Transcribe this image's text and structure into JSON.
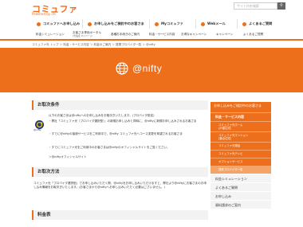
{
  "header": {
    "logo": "コミュファ",
    "logo_sub": "Powered by ctc",
    "search_placeholder": "サイト内を検索",
    "search_button": "Q",
    "topnav": [
      {
        "label": "コミュファへお申し込み"
      },
      {
        "label": "お申し込みをご検討中のお客さま"
      },
      {
        "label": "Myコミュファ"
      },
      {
        "label": "Webメール"
      },
      {
        "label": "よくあるご質問"
      }
    ],
    "subnav": [
      {
        "label": "料金シミュレーション",
        "small": ""
      },
      {
        "label": "お客さま専用ポータル",
        "small": "(光電話 マイページ)"
      },
      {
        "label": "各種お手続きのご案内",
        "small": ""
      },
      {
        "label": "料金・サービス内容",
        "small": ""
      },
      {
        "label": "お得なキャンペーン",
        "small": ""
      },
      {
        "label": "キャンペーン",
        "small": ""
      },
      {
        "label": "よくあるご質問",
        "small": ""
      }
    ]
  },
  "breadcrumb": "コミュファ光 トップ ＞ 料金・サービス内容 ＞ 料金のご案内 ＞ 提携プロバイダ一覧 ＞ @nifty",
  "hero": {
    "title": "@nifty"
  },
  "conditions": {
    "heading": "お取次条件",
    "badge_text": "@nifty",
    "para_main": "以下のお客さまは@niftyへのお申し込みをお取次ぎいたします。(プロバイダ設定)",
    "bullets": [
      "・弊社「コミュファ光（プロバイダ選択型）」の新規お申し込みと同時に、@niftyに新規お申し込みされるお客さま",
      "・すでに@niftyの接続サービスをご利用中で、@nifty コミュファ光へコース変更を希望されるお客さま",
      "・すでにコミュファ光をご利用中のお客さまは@niftyのオフィシャルサイトをご覧ください。"
    ],
    "link": "＞@niftyオフィシャルサイト"
  },
  "method": {
    "heading": "お取次方法",
    "para": "コミュファ光「プロバイダ選択型」でお申し込みいただく際、@niftyをお申し込みいただけますと、弊社より@niftyにお客さまのお申し込み情報をお取次ぎいたします。(お客さまから@niftyへお申し込みいただく必要はございません。)"
  },
  "fees": {
    "heading": "料金表"
  },
  "sidebar": {
    "header": "お申し込みをご検討中のお客さま",
    "sections": [
      {
        "label": "料金・サービス内容"
      }
    ],
    "subs": [
      {
        "line1": "コミュファ光ホーム",
        "line2": "(戸建住宅)"
      },
      {
        "line1": "コミュファ光マンション",
        "line2": "(集合住宅)"
      },
      {
        "line1": "コミュファ光電話",
        "line2": ""
      },
      {
        "line1": "コミュファ光テレビ",
        "line2": ""
      },
      {
        "line1": "オプションサービス",
        "line2": ""
      },
      {
        "line1": "提携プロバイダ一覧",
        "line2": ""
      }
    ],
    "light_items": [
      {
        "label": "料金シミュレーション"
      },
      {
        "label": "よくあるご質問"
      },
      {
        "label": "お申し込み"
      },
      {
        "label": "資料請求のご案内"
      }
    ]
  },
  "colors": {
    "accent": "#ee6f1b"
  }
}
